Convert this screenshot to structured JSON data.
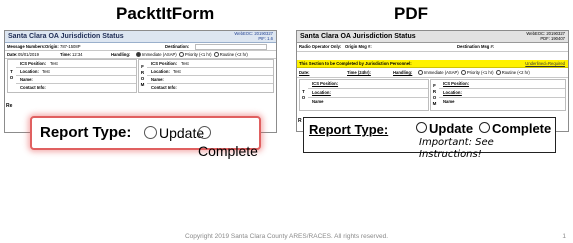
{
  "headings": {
    "left": "PacktItForm",
    "right": "PDF"
  },
  "packit": {
    "title": "Santa Clara OA Jurisdiction Status",
    "meta_line1": "WebEOC: 20190327",
    "meta_line2": "PIF: 1.6",
    "message_numbers_label": "Message Numbers:",
    "origin_label": "Origin:",
    "origin_value": "787-1508P",
    "destination_label": "Destination:",
    "date_label": "Date:",
    "date_value": "05/01/2019",
    "time_label": "Time:",
    "time_value": "12:34",
    "handling_label": "Handling:",
    "handling_immediate": "Immediate (ASAP)",
    "handling_priority": "Priority (<1 hr)",
    "handling_routine": "Routine (<2 hr)",
    "to_letters": [
      "T",
      "O"
    ],
    "from_letters": [
      "F",
      "R",
      "O",
      "M"
    ],
    "to_position_label": "ICS Position:",
    "to_position_value": "Test",
    "to_location_label": "Location:",
    "to_location_value": "Test",
    "to_name_label": "Name:",
    "to_contact_label": "Contact Info:",
    "from_position_label": "ICS Position:",
    "from_position_value": "Test",
    "from_location_label": "Location:",
    "from_location_value": "Test",
    "from_name_label": "Name:",
    "from_contact_label": "Contact Info:",
    "cut_label": "Re"
  },
  "pdf": {
    "title": "Santa Clara OA Jurisdiction Status",
    "meta_line1": "WebEOC: 20190327",
    "meta_line2": "PDF: 190407",
    "radio_operator_label": "Radio Operator Only:",
    "origin_msg_label": "Origin Msg #:",
    "destination_msg_label": "Destination Msg #:",
    "jurisdiction_note": "This Section to be Completed by Jurisdiction Personnel:",
    "underlined_required": "Underlined=Required",
    "date_label": "Date:",
    "time_label": "Time (24hr):",
    "handling_label": "Handling:",
    "handling_immediate": "Immediate (ASAP)",
    "handling_priority": "Priority (<1 hr)",
    "handling_routine": "Routine (<2 hr)",
    "to_letters": [
      "T",
      "O"
    ],
    "from_letters": [
      "F",
      "R",
      "O",
      "M"
    ],
    "to_position_label": "ICS Position:",
    "to_location_label": "Location:",
    "to_name_label": "Name",
    "from_position_label": "ICS Position:",
    "from_location_label": "Location:",
    "from_name_label": "Name",
    "cut_label": "R"
  },
  "report_type_packit": {
    "label": "Report Type:",
    "option_update": "Update",
    "option_complete": "Complete"
  },
  "report_type_pdf": {
    "label": "Report Type:",
    "option_update": "Update",
    "option_complete": "Complete",
    "note": "Important:  See Instructions!"
  },
  "footer": {
    "copyright": "Copyright 2019 Santa Clara County ARES/RACES.  All rights reserved.",
    "page_number": "1"
  },
  "colors": {
    "highlight_border": "#e06060",
    "yellow_bar": "#fff200",
    "title_bg": "#dde6f1"
  }
}
